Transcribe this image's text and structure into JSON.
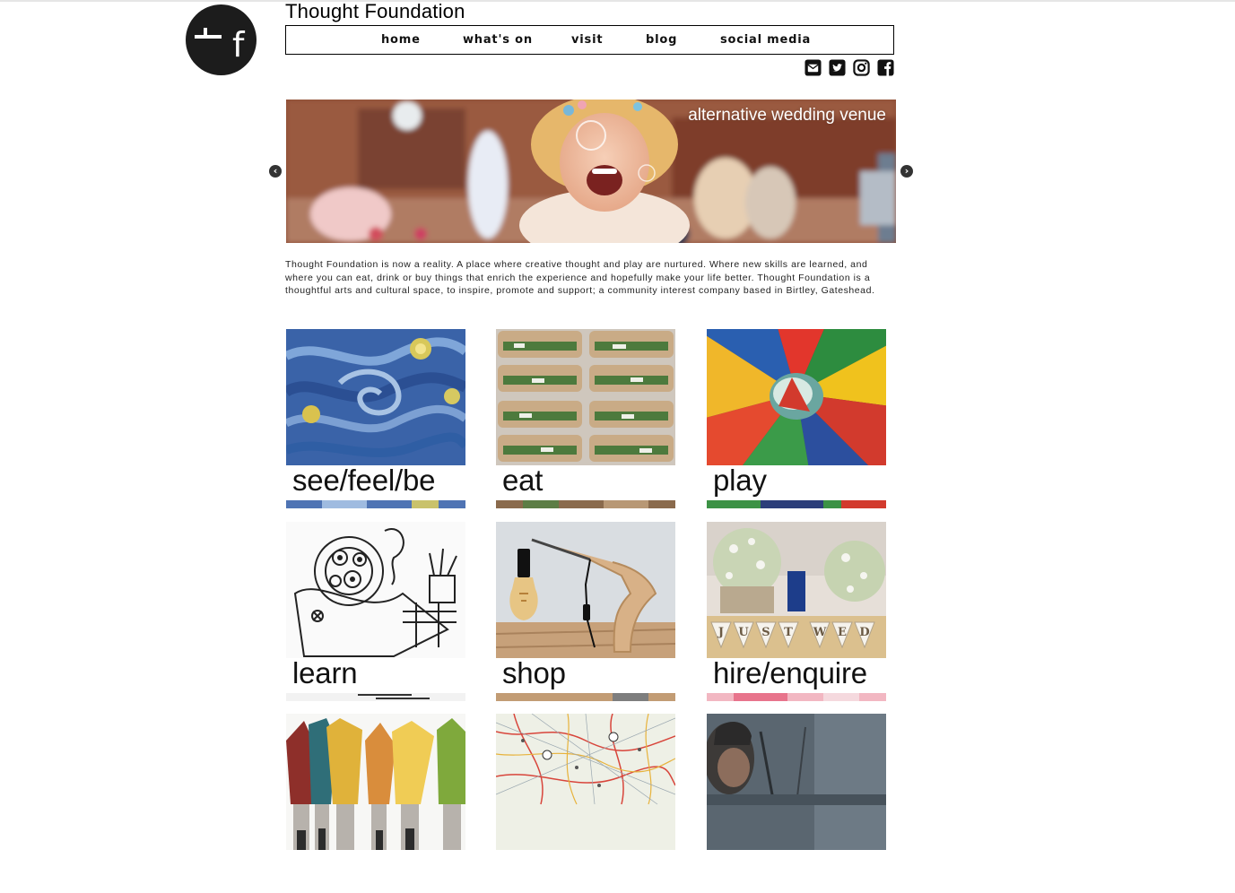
{
  "site": {
    "title": "Thought Foundation"
  },
  "nav": {
    "items": [
      "home",
      "what's on",
      "visit",
      "blog",
      "social media"
    ]
  },
  "social": {
    "icons": [
      "email-icon",
      "twitter-icon",
      "instagram-icon",
      "facebook-icon"
    ]
  },
  "slider": {
    "caption": "alternative wedding venue",
    "prev_icon": "chevron-left-icon",
    "next_icon": "chevron-right-icon"
  },
  "intro": {
    "text": "Thought Foundation is now a reality. A place where creative thought and play are nurtured. Where new skills are learned, and where you can eat, drink or buy things that enrich the experience and hopefully make your life better. Thought Foundation is a thoughtful arts and cultural space, to inspire, promote and support; a community interest company based in Birtley, Gateshead."
  },
  "tiles": [
    {
      "label": "see/feel/be"
    },
    {
      "label": "eat"
    },
    {
      "label": "play"
    },
    {
      "label": "learn"
    },
    {
      "label": "shop"
    },
    {
      "label": "hire/enquire"
    },
    {
      "label": ""
    },
    {
      "label": ""
    },
    {
      "label": ""
    }
  ],
  "colors": {
    "text": "#111111",
    "logo_bg": "#1c1c1c",
    "nav_border": "#000000",
    "background": "#ffffff"
  }
}
